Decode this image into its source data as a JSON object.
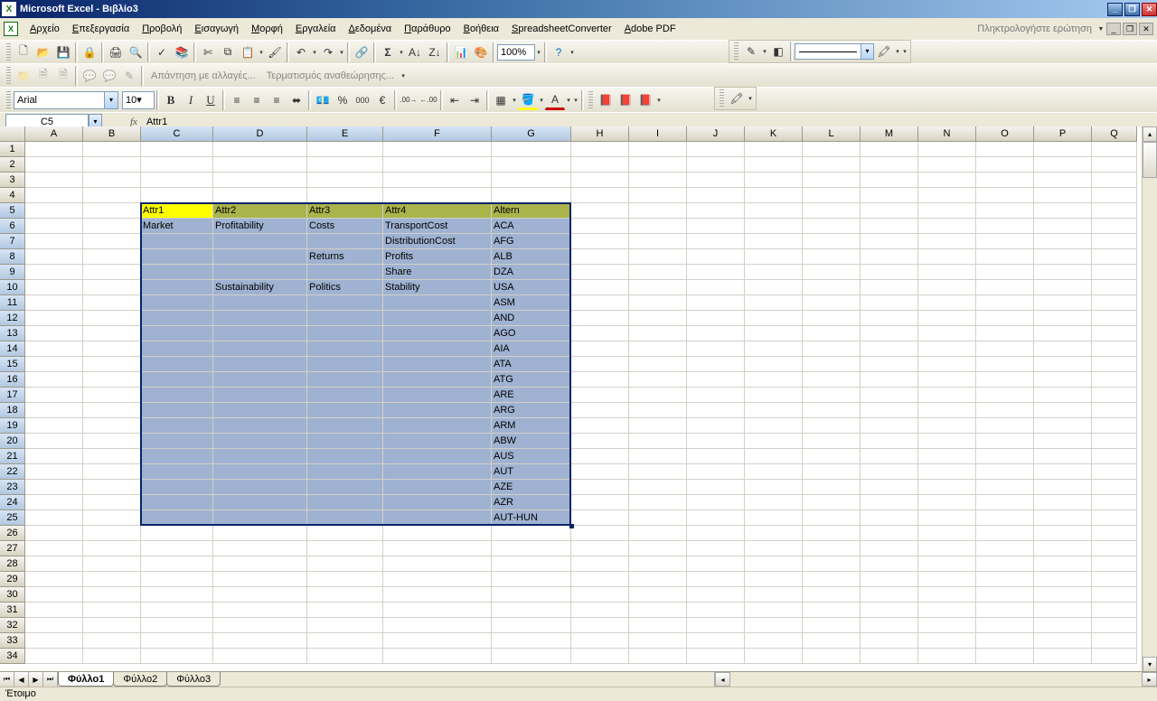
{
  "titlebar": {
    "app": "Microsoft Excel",
    "doc": "Βιβλίο3"
  },
  "menus": [
    "Αρχείο",
    "Επεξεργασία",
    "Προβολή",
    "Εισαγωγή",
    "Μορφή",
    "Εργαλεία",
    "Δεδομένα",
    "Παράθυρο",
    "Βοήθεια",
    "SpreadsheetConverter",
    "Adobe PDF"
  ],
  "ask_question": "Πληκτρολογήστε ερώτηση",
  "zoom": "100%",
  "review": {
    "reply_changes": "Απάντηση με αλλαγές...",
    "end_review": "Τερματισμός αναθεώρησης..."
  },
  "font": {
    "name": "Arial",
    "size": "10"
  },
  "namebox": "C5",
  "fx": "fx",
  "formula_value": "Attr1",
  "columns": [
    "A",
    "B",
    "C",
    "D",
    "E",
    "F",
    "G",
    "H",
    "I",
    "J",
    "K",
    "L",
    "M",
    "N",
    "O",
    "P",
    "Q"
  ],
  "sel_cols": [
    "C",
    "D",
    "E",
    "F",
    "G"
  ],
  "sel_rows_start": 5,
  "sel_rows_end": 25,
  "active_cell": {
    "row": 5,
    "col": "C"
  },
  "cells": {
    "5": {
      "C": "Attr1",
      "D": "Attr2",
      "E": "Attr3",
      "F": "Attr4",
      "G": "Altern"
    },
    "6": {
      "C": "Market",
      "D": "Profitability",
      "E": "Costs",
      "F": "TransportCost",
      "G": "ACA"
    },
    "7": {
      "F": "DistributionCost",
      "G": "AFG"
    },
    "8": {
      "E": "Returns",
      "F": "Profits",
      "G": "ALB"
    },
    "9": {
      "F": "Share",
      "G": "DZA"
    },
    "10": {
      "D": "Sustainability",
      "E": "Politics",
      "F": "Stability",
      "G": "USA"
    },
    "11": {
      "G": "ASM"
    },
    "12": {
      "G": "AND"
    },
    "13": {
      "G": "AGO"
    },
    "14": {
      "G": "AIA"
    },
    "15": {
      "G": "ATA"
    },
    "16": {
      "G": "ATG"
    },
    "17": {
      "G": "ARE"
    },
    "18": {
      "G": "ARG"
    },
    "19": {
      "G": "ARM"
    },
    "20": {
      "G": "ABW"
    },
    "21": {
      "G": "AUS"
    },
    "22": {
      "G": "AUT"
    },
    "23": {
      "G": "AZE"
    },
    "24": {
      "G": "AZR"
    },
    "25": {
      "G": "AUT-HUN"
    }
  },
  "header_row": 5,
  "row_count": 34,
  "tabs": [
    "Φύλλο1",
    "Φύλλο2",
    "Φύλλο3"
  ],
  "active_tab": 0,
  "status": "Έτοιμο"
}
